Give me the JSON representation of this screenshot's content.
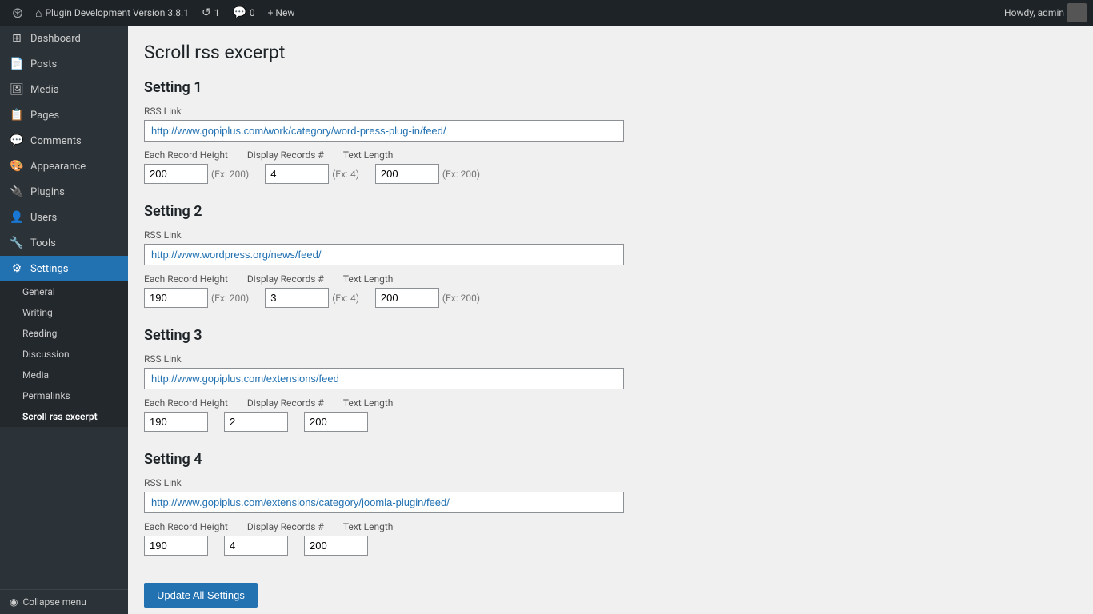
{
  "topbar": {
    "site_name": "Plugin Development Version 3.8.1",
    "updates_count": "1",
    "comments_count": "0",
    "new_label": "+ New",
    "howdy_label": "Howdy, admin"
  },
  "sidebar": {
    "items": [
      {
        "id": "dashboard",
        "label": "Dashboard",
        "icon": "⊞"
      },
      {
        "id": "posts",
        "label": "Posts",
        "icon": "📄"
      },
      {
        "id": "media",
        "label": "Media",
        "icon": "🖼"
      },
      {
        "id": "pages",
        "label": "Pages",
        "icon": "📋"
      },
      {
        "id": "comments",
        "label": "Comments",
        "icon": "💬"
      },
      {
        "id": "appearance",
        "label": "Appearance",
        "icon": "🎨"
      },
      {
        "id": "plugins",
        "label": "Plugins",
        "icon": "🔌"
      },
      {
        "id": "users",
        "label": "Users",
        "icon": "👤"
      },
      {
        "id": "tools",
        "label": "Tools",
        "icon": "🔧"
      },
      {
        "id": "settings",
        "label": "Settings",
        "icon": "⚙"
      }
    ],
    "settings_sub": [
      {
        "id": "general",
        "label": "General"
      },
      {
        "id": "writing",
        "label": "Writing"
      },
      {
        "id": "reading",
        "label": "Reading"
      },
      {
        "id": "discussion",
        "label": "Discussion"
      },
      {
        "id": "media",
        "label": "Media"
      },
      {
        "id": "permalinks",
        "label": "Permalinks"
      },
      {
        "id": "scroll-rss",
        "label": "Scroll rss excerpt"
      }
    ],
    "collapse_label": "Collapse menu"
  },
  "page": {
    "title": "Scroll rss excerpt",
    "settings": [
      {
        "heading": "Setting 1",
        "rss_link_label": "RSS Link",
        "rss_link_value": "http://www.gopiplus.com/work/category/word-press-plug-in/feed/",
        "each_record_height_label": "Each Record Height",
        "each_record_height_value": "200",
        "each_record_height_hint": "(Ex: 200)",
        "display_records_label": "Display Records #",
        "display_records_value": "4",
        "display_records_hint": "(Ex: 4)",
        "text_length_label": "Text Length",
        "text_length_value": "200",
        "text_length_hint": "(Ex: 200)"
      },
      {
        "heading": "Setting 2",
        "rss_link_label": "RSS Link",
        "rss_link_value": "http://www.wordpress.org/news/feed/",
        "each_record_height_label": "Each Record Height",
        "each_record_height_value": "190",
        "each_record_height_hint": "(Ex: 200)",
        "display_records_label": "Display Records #",
        "display_records_value": "3",
        "display_records_hint": "(Ex: 4)",
        "text_length_label": "Text Length",
        "text_length_value": "200",
        "text_length_hint": "(Ex: 200)"
      },
      {
        "heading": "Setting 3",
        "rss_link_label": "RSS Link",
        "rss_link_value": "http://www.gopiplus.com/extensions/feed",
        "each_record_height_label": "Each Record Height",
        "each_record_height_value": "190",
        "each_record_height_hint": "",
        "display_records_label": "Display Records #",
        "display_records_value": "2",
        "display_records_hint": "",
        "text_length_label": "Text Length",
        "text_length_value": "200",
        "text_length_hint": ""
      },
      {
        "heading": "Setting 4",
        "rss_link_label": "RSS Link",
        "rss_link_value": "http://www.gopiplus.com/extensions/category/joomla-plugin/feed/",
        "each_record_height_label": "Each Record Height",
        "each_record_height_value": "190",
        "each_record_height_hint": "",
        "display_records_label": "Display Records #",
        "display_records_value": "4",
        "display_records_hint": "",
        "text_length_label": "Text Length",
        "text_length_value": "200",
        "text_length_hint": ""
      }
    ],
    "update_button_label": "Update All Settings"
  }
}
